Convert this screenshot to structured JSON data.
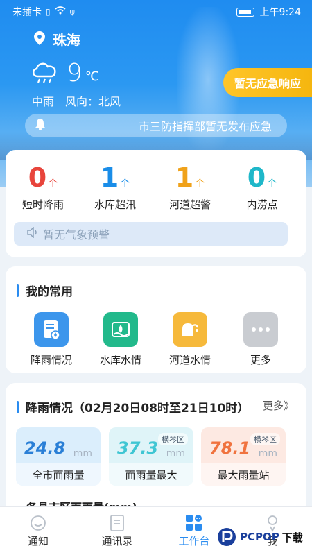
{
  "status_bar": {
    "carrier": "未插卡",
    "time": "上午9:24"
  },
  "location": {
    "city": "珠海"
  },
  "weather": {
    "temp": "9",
    "unit": "℃",
    "condition": "中雨",
    "wind": "风向：北风"
  },
  "emergency_button": "暂无应急响应",
  "ticker": "市三防指挥部暂无发布应急",
  "stats": [
    {
      "value": "0",
      "unit": "个",
      "label": "短时降雨",
      "color": "#e8453c"
    },
    {
      "value": "1",
      "unit": "个",
      "label": "水库超汛",
      "color": "#1a8de8"
    },
    {
      "value": "1",
      "unit": "个",
      "label": "河道超警",
      "color": "#f0a21a"
    },
    {
      "value": "0",
      "unit": "个",
      "label": "内涝点",
      "color": "#1fb7c9"
    }
  ],
  "weather_warning": "暂无气象预警",
  "favorites": {
    "title": "我的常用",
    "items": [
      {
        "label": "降雨情况",
        "icon": "rain-report-icon",
        "color": "#3c96ec"
      },
      {
        "label": "水库水情",
        "icon": "reservoir-icon",
        "color": "#22b98b"
      },
      {
        "label": "河道水情",
        "icon": "river-icon",
        "color": "#f6b93b"
      },
      {
        "label": "更多",
        "icon": "more-icon",
        "color": "#c9ccd1"
      }
    ]
  },
  "rainfall": {
    "title": "降雨情况（02月20日08时至21日10时）",
    "more": "更多》",
    "boxes": [
      {
        "value": "24.8",
        "unit": "mm",
        "tag": "",
        "caption": "全市面雨量",
        "color": "#2a7fd6",
        "bg": "#dbeefc"
      },
      {
        "value": "37.3",
        "unit": "mm",
        "tag": "横琴区",
        "caption": "面雨量最大",
        "color": "#3fc6d3",
        "bg": "#dff4f8"
      },
      {
        "value": "78.1",
        "unit": "mm",
        "tag": "横琴区",
        "caption": "最大雨量站",
        "color": "#f0733f",
        "bg": "#fde9e2"
      }
    ],
    "subtitle": "各县市区面雨量(mm)"
  },
  "tabs": [
    {
      "label": "通知",
      "icon": "notice-icon"
    },
    {
      "label": "通讯录",
      "icon": "contacts-icon"
    },
    {
      "label": "工作台",
      "icon": "workbench-icon"
    },
    {
      "label": "我",
      "icon": "profile-icon"
    }
  ],
  "active_tab": "工作台",
  "watermark": {
    "brand": "PCPOP",
    "text": "下载"
  }
}
